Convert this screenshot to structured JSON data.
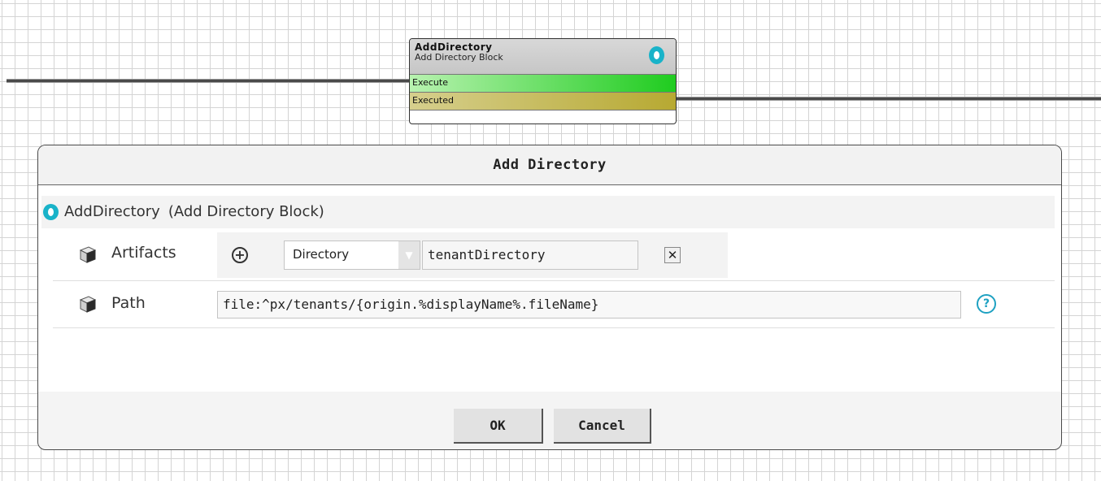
{
  "block": {
    "title": "AddDirectory",
    "subtitle": "Add Directory Block",
    "ports": {
      "input": "Execute",
      "output": "Executed"
    }
  },
  "dialog": {
    "title": "Add  Directory",
    "header": {
      "name": "AddDirectory",
      "type": "(Add Directory Block)"
    },
    "fields": {
      "artifacts": {
        "label": "Artifacts",
        "type_value": "Directory",
        "name_value": "tenantDirectory"
      },
      "path": {
        "label": "Path",
        "value": "file:^px/tenants/{origin.%displayName%.fileName}"
      }
    },
    "buttons": {
      "ok": "OK",
      "cancel": "Cancel"
    }
  },
  "colors": {
    "accent": "#19b3c9",
    "execute_port": "#1fcc1f",
    "executed_port": "#b7a932"
  }
}
